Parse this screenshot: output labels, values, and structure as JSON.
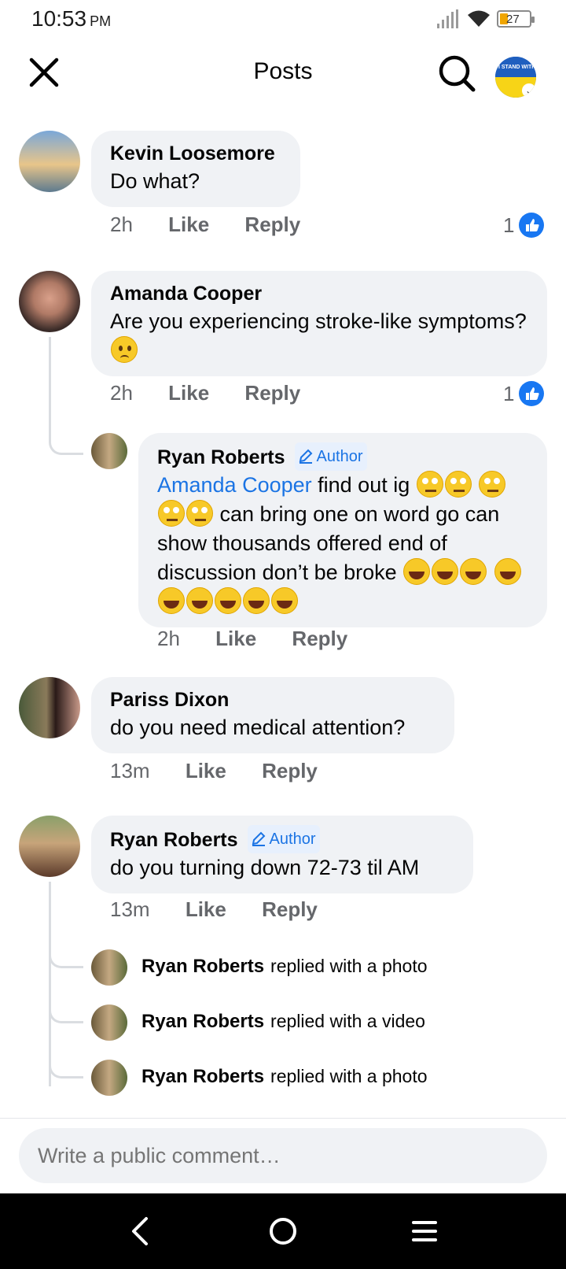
{
  "status_bar": {
    "time": "10:53",
    "ampm": "PM",
    "battery": "27"
  },
  "header": {
    "title": "Posts",
    "profile_badge_text": "I STAND WITH"
  },
  "comments": [
    {
      "name": "Kevin Loosemore",
      "text": "Do what?",
      "time": "2h",
      "like": "Like",
      "reply": "Reply",
      "reactions": "1"
    },
    {
      "name": "Amanda Cooper",
      "text": "Are you experiencing stroke-like symptoms?",
      "time": "2h",
      "like": "Like",
      "reply": "Reply",
      "reactions": "1"
    },
    {
      "name": "Ryan Roberts",
      "badge": "Author",
      "mention": "Amanda Cooper",
      "text_1": "find out ig",
      "text_2": "can bring one on word go can show thousands offered end of discussion don’t be broke",
      "time": "2h",
      "like": "Like",
      "reply": "Reply"
    },
    {
      "name": "Pariss Dixon",
      "text": "do you need medical attention?",
      "time": "13m",
      "like": "Like",
      "reply": "Reply"
    },
    {
      "name": "Ryan Roberts",
      "badge": "Author",
      "text": "do you turning down 72-73 til AM",
      "time": "13m",
      "like": "Like",
      "reply": "Reply"
    }
  ],
  "collapsed_replies": [
    {
      "name": "Ryan Roberts",
      "text": "replied with a photo"
    },
    {
      "name": "Ryan Roberts",
      "text": "replied with a video"
    },
    {
      "name": "Ryan Roberts",
      "text": "replied with a photo"
    }
  ],
  "composer": {
    "placeholder": "Write a public comment…"
  },
  "colors": {
    "accent": "#1877f2",
    "bubble": "#f0f2f5",
    "meta": "#65676b"
  },
  "icons": [
    "close-icon",
    "search-icon",
    "like-icon",
    "pencil-icon",
    "back-icon",
    "home-icon",
    "menu-icon"
  ]
}
